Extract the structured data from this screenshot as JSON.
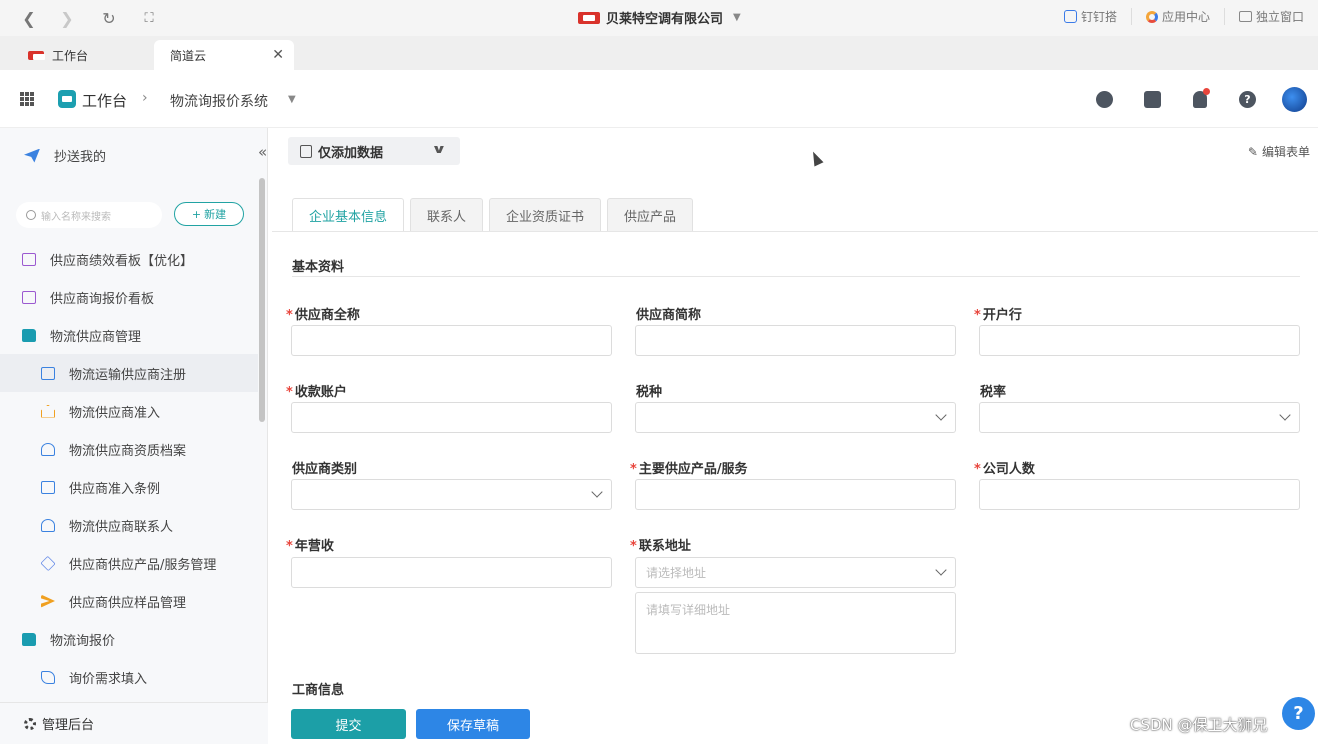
{
  "browser": {
    "company": "贝莱特空调有限公司",
    "right_items": [
      "钉钉搭",
      "应用中心",
      "独立窗口"
    ],
    "tabs": [
      "工作台",
      "简道云"
    ]
  },
  "header": {
    "workspace": "工作台",
    "system": "物流询报价系统"
  },
  "sidebar": {
    "cc_label": "抄送我的",
    "search_placeholder": "输入名称来搜索",
    "new_label": "新建",
    "items": [
      {
        "label": "供应商绩效看板【优化】",
        "icon": "monitor-icon"
      },
      {
        "label": "供应商询报价看板",
        "icon": "monitor-icon"
      },
      {
        "label": "物流供应商管理",
        "icon": "folder-icon"
      },
      {
        "label": "物流运输供应商注册",
        "icon": "document-icon"
      },
      {
        "label": "物流供应商准入",
        "icon": "home-icon"
      },
      {
        "label": "物流供应商资质档案",
        "icon": "person-icon"
      },
      {
        "label": "供应商准入条例",
        "icon": "document-icon"
      },
      {
        "label": "物流供应商联系人",
        "icon": "person-icon"
      },
      {
        "label": "供应商供应产品/服务管理",
        "icon": "box-icon"
      },
      {
        "label": "供应商供应样品管理",
        "icon": "send-icon"
      },
      {
        "label": "物流询报价",
        "icon": "folder-icon"
      },
      {
        "label": "询价需求填入",
        "icon": "tag-icon"
      }
    ],
    "admin_label": "管理后台"
  },
  "toolbar": {
    "filter_label": "仅添加数据",
    "edit_form_label": "编辑表单"
  },
  "form": {
    "tabs": [
      "企业基本信息",
      "联系人",
      "企业资质证书",
      "供应产品"
    ],
    "section_basic": "基本资料",
    "section_business": "工商信息",
    "fields": {
      "full_name": "供应商全称",
      "short_name": "供应商简称",
      "bank": "开户行",
      "account": "收款账户",
      "tax_type": "税种",
      "tax_rate": "税率",
      "category": "供应商类别",
      "main_product": "主要供应产品/服务",
      "headcount": "公司人数",
      "revenue": "年营收",
      "address": "联系地址"
    },
    "address_select_placeholder": "请选择地址",
    "address_detail_placeholder": "请填写详细地址"
  },
  "footer": {
    "submit_label": "提交",
    "draft_label": "保存草稿"
  },
  "watermark": "CSDN @保卫大狮兄"
}
